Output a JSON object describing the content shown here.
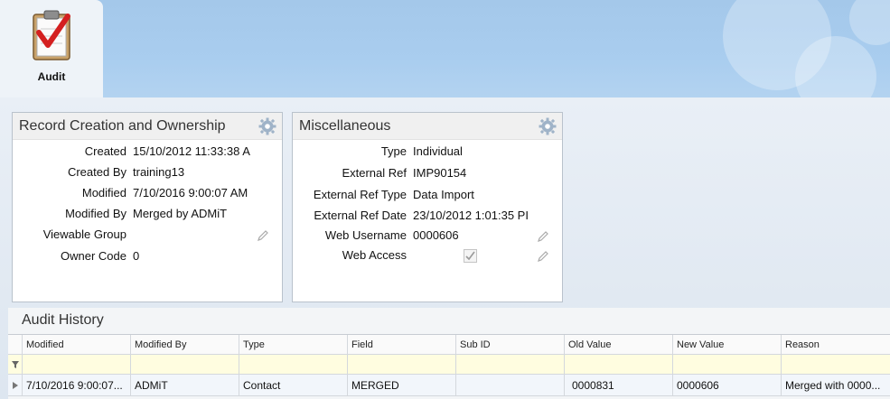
{
  "banner": {
    "tab_label": "Audit",
    "icon": "clipboard-check-icon"
  },
  "record_panel": {
    "title": "Record Creation and Ownership",
    "fields": [
      {
        "label": "Created",
        "value": "15/10/2012 11:33:38 A"
      },
      {
        "label": "Created By",
        "value": "training13"
      },
      {
        "label": "Modified",
        "value": "7/10/2016 9:00:07 AM"
      },
      {
        "label": "Modified By",
        "value": "Merged by ADMiT"
      },
      {
        "label": "Viewable Group",
        "value": ""
      },
      {
        "label": "Owner Code",
        "value": "0"
      }
    ]
  },
  "misc_panel": {
    "title": "Miscellaneous",
    "fields": [
      {
        "label": "Type",
        "value": "Individual"
      },
      {
        "label": "External Ref",
        "value": "IMP90154"
      },
      {
        "label": "External Ref Type",
        "value": "Data Import"
      },
      {
        "label": "External Ref Date",
        "value": "23/10/2012 1:01:35 PI"
      },
      {
        "label": "Web Username",
        "value": "0000606"
      },
      {
        "label": "Web Access",
        "value": ""
      }
    ],
    "web_access_checked": true
  },
  "history": {
    "title": "Audit History",
    "columns": [
      "Modified",
      "Modified By",
      "Type",
      "Field",
      "Sub ID",
      "Old Value",
      "New Value",
      "Reason"
    ],
    "rows": [
      [
        "7/10/2016 9:00:07...",
        "ADMiT",
        "Contact",
        "MERGED",
        "",
        "0000831",
        "0000606",
        "Merged with 0000..."
      ]
    ]
  },
  "colors": {
    "banner": "#a9cdef",
    "panel_header": "#f0f0f0",
    "filter_row": "#fffde0",
    "check_red": "#d42020"
  }
}
